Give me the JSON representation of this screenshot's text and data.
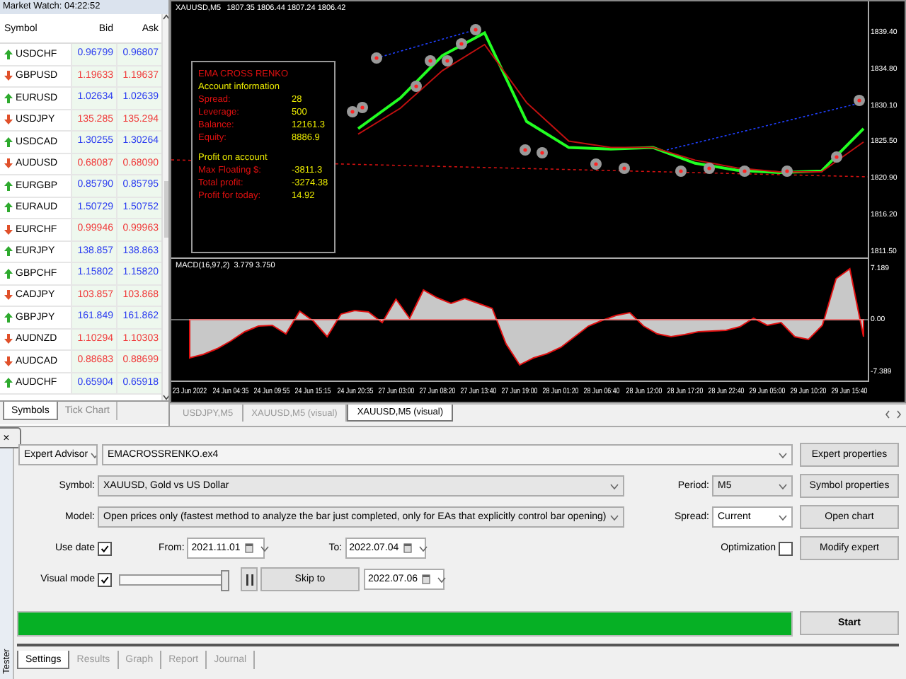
{
  "market_watch": {
    "title": "Market Watch: 04:22:52",
    "columns": [
      "Symbol",
      "Bid",
      "Ask"
    ],
    "rows": [
      {
        "symbol": "USDCHF",
        "bid": "0.96799",
        "ask": "0.96807",
        "kind": "up"
      },
      {
        "symbol": "GBPUSD",
        "bid": "1.19633",
        "ask": "1.19637",
        "kind": "down"
      },
      {
        "symbol": "EURUSD",
        "bid": "1.02634",
        "ask": "1.02639",
        "kind": "up"
      },
      {
        "symbol": "USDJPY",
        "bid": "135.285",
        "ask": "135.294",
        "kind": "down"
      },
      {
        "symbol": "USDCAD",
        "bid": "1.30255",
        "ask": "1.30264",
        "kind": "up"
      },
      {
        "symbol": "AUDUSD",
        "bid": "0.68087",
        "ask": "0.68090",
        "kind": "down"
      },
      {
        "symbol": "EURGBP",
        "bid": "0.85790",
        "ask": "0.85795",
        "kind": "up"
      },
      {
        "symbol": "EURAUD",
        "bid": "1.50729",
        "ask": "1.50752",
        "kind": "up"
      },
      {
        "symbol": "EURCHF",
        "bid": "0.99946",
        "ask": "0.99963",
        "kind": "down"
      },
      {
        "symbol": "EURJPY",
        "bid": "138.857",
        "ask": "138.863",
        "kind": "up"
      },
      {
        "symbol": "GBPCHF",
        "bid": "1.15802",
        "ask": "1.15820",
        "kind": "up"
      },
      {
        "symbol": "CADJPY",
        "bid": "103.857",
        "ask": "103.868",
        "kind": "down"
      },
      {
        "symbol": "GBPJPY",
        "bid": "161.849",
        "ask": "161.862",
        "kind": "up"
      },
      {
        "symbol": "AUDNZD",
        "bid": "1.10294",
        "ask": "1.10303",
        "kind": "down"
      },
      {
        "symbol": "AUDCAD",
        "bid": "0.88683",
        "ask": "0.88699",
        "kind": "down"
      },
      {
        "symbol": "AUDCHF",
        "bid": "0.65904",
        "ask": "0.65918",
        "kind": "up"
      }
    ],
    "tabs": [
      {
        "label": "Symbols",
        "selected": true
      },
      {
        "label": "Tick Chart",
        "selected": false
      }
    ]
  },
  "chart": {
    "header_values": "1807.35 1806.44 1807.24 1806.42",
    "info_panel": {
      "title": "EMA CROSS RENKO",
      "section_1": "Account information",
      "rows_1": [
        {
          "label": "Spread:",
          "value": "28"
        },
        {
          "label": "Leverage:",
          "value": "500"
        },
        {
          "label": "Balance:",
          "value": "12161.3"
        },
        {
          "label": "Equity:",
          "value": "8886.9"
        }
      ],
      "section_2": "Profit on account",
      "rows_2": [
        {
          "label": "Max Floating $:",
          "value": "-3811.3"
        },
        {
          "label": "Total profit:",
          "value": "-3274.38"
        },
        {
          "label": "Profit for today:",
          "value": "14.92"
        }
      ]
    },
    "chart_data": {
      "type": "line",
      "categories": [
        null,
        null,
        null,
        null,
        null,
        null,
        null,
        null,
        null,
        null,
        null,
        null,
        null,
        null,
        null,
        null,
        null
      ],
      "series": [
        {
          "name": "XAUUSD,M5",
          "color": "#22ff22",
          "values": [
            null,
            null,
            null,
            null,
            1827.2,
            1831.1,
            1836.5,
            1839.4,
            1828.1,
            1824.8,
            1824.6,
            1824.8,
            1822.8,
            1821.9,
            1821.6,
            1821.8,
            1827.2
          ]
        },
        {
          "color": "#c01010",
          "values": [
            null,
            null,
            null,
            null,
            1826.5,
            1829.8,
            1834.6,
            1837.9,
            1830.5,
            1825.6,
            1824.8,
            1824.8,
            1823.2,
            1822.2,
            1821.7,
            1821.7,
            1825.5
          ]
        }
      ],
      "ylim": [
        1810.8,
        1843.4
      ],
      "yticks": [
        {
          "value": 1839.4,
          "label": "1839.40"
        },
        {
          "value": 1834.8,
          "label": "1834.80"
        },
        {
          "value": 1830.1,
          "label": "1830.10"
        },
        {
          "value": 1825.5,
          "label": "1825.50"
        },
        {
          "value": 1820.9,
          "label": "1820.90"
        },
        {
          "value": 1816.2,
          "label": "1816.20"
        },
        {
          "value": 1811.5,
          "label": "1811.50"
        }
      ]
    },
    "indicator": {
      "values": "3.779 3.750",
      "chart_data": {
        "type": "area",
        "categories": [
          "23 Jun 2022",
          null,
          null,
          "24 Jun 04:35",
          null,
          null,
          "24 Jun 09:55",
          null,
          null,
          "24 Jun 15:15",
          null,
          null,
          "24 Jun 20:35",
          null,
          null,
          "27 Jun 03:00",
          null,
          null,
          "27 Jun 08:20",
          null,
          null,
          "27 Jun 13:40",
          null,
          null,
          "27 Jun 19:00",
          null,
          null,
          "28 Jun 01:20",
          null,
          null,
          "28 Jun 06:40",
          null,
          null,
          "28 Jun 12:00",
          null,
          null,
          "28 Jun 17:20",
          null,
          null,
          "28 Jun 22:40",
          null,
          null,
          "29 Jun 05:00",
          null,
          null,
          "29 Jun 10:20",
          null,
          null,
          "29 Jun 15:40",
          null
        ],
        "series": [
          {
            "name": "MACD(16,97,2)",
            "color": "#c8c8c8",
            "values": [
              -5.4,
              -4.9,
              -4.1,
              -3.0,
              -1.7,
              -0.9,
              -0.8,
              -2.0,
              1.2,
              -0.2,
              -2.4,
              0.8,
              1.3,
              1.1,
              -0.4,
              2.9,
              0.2,
              4.2,
              3.1,
              2.3,
              3.0,
              2.3,
              1.6,
              -3.4,
              -6.4,
              -5.4,
              -4.8,
              -3.9,
              -2.4,
              -0.9,
              -0.1,
              0.6,
              1.0,
              -0.9,
              -2.0,
              -2.4,
              -2.1,
              -1.7,
              -1.6,
              -1.5,
              -1.0,
              0.2,
              -0.8,
              -0.4,
              -2.4,
              -2.8,
              -0.8,
              5.8,
              7.2,
              -2.4
            ]
          }
        ],
        "ylim": [
          -8.6,
          8.6
        ],
        "yticks": [
          {
            "value": 7.189,
            "label": "7.189"
          },
          {
            "value": 0,
            "label": "0.00"
          },
          {
            "value": -7.389,
            "label": "-7.389"
          }
        ]
      }
    }
  },
  "chart_tabs": [
    {
      "label": "USDJPY,M5",
      "selected": false
    },
    {
      "label": "XAUUSD,M5 (visual)",
      "selected": false
    },
    {
      "label": "XAUUSD,M5 (visual)",
      "selected": true
    }
  ],
  "tester": {
    "side_label": "Tester",
    "close": "×",
    "type": "Expert Advisor",
    "expert": "EMACROSSRENKO.ex4",
    "symbol_label": "Symbol:",
    "symbol": "XAUUSD, Gold vs US Dollar",
    "model_label": "Model:",
    "model": "Open prices only (fastest method to analyze the bar just completed, only for EAs that explicitly control bar opening)",
    "period_label": "Period:",
    "period": "M5",
    "spread_label": "Spread:",
    "spread": "Current",
    "use_date": {
      "label": "Use date",
      "checked": true
    },
    "from_label": "From:",
    "from": "2021.11.01",
    "to_label": "To:",
    "to": "2022.07.04",
    "optimization": {
      "label": "Optimization",
      "checked": false
    },
    "visual_mode": {
      "label": "Visual mode",
      "checked": true
    },
    "speed": {
      "level": 0.97
    },
    "skip_button": "Skip to",
    "skip_date": "2022.07.06",
    "progress": {
      "level": 1
    },
    "buttons": [
      "Expert properties",
      "Symbol properties",
      "Open chart",
      "Modify expert"
    ],
    "start": "Start",
    "tabs": [
      {
        "label": "Settings",
        "selected": true
      },
      {
        "label": "Results",
        "selected": false
      },
      {
        "label": "Graph",
        "selected": false
      },
      {
        "label": "Report",
        "selected": false
      },
      {
        "label": "Journal",
        "selected": false
      }
    ]
  }
}
